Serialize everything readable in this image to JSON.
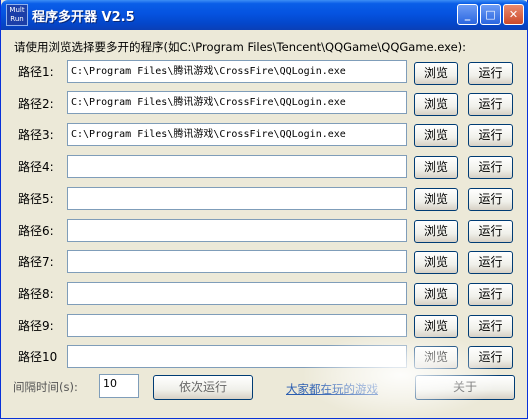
{
  "window": {
    "icon_text": "Mult\nRun",
    "title": "程序多开器 V2.5",
    "controls": {
      "minimize": "_",
      "maximize": "□",
      "close": "✕"
    }
  },
  "instruction": "请使用浏览选择要多开的程序(如C:\\Program Files\\Tencent\\QQGame\\QQGame.exe):",
  "rows": [
    {
      "label": "路径1:",
      "value": "C:\\Program Files\\腾讯游戏\\CrossFire\\QQLogin.exe",
      "browse": "浏览",
      "run": "运行"
    },
    {
      "label": "路径2:",
      "value": "C:\\Program Files\\腾讯游戏\\CrossFire\\QQLogin.exe",
      "browse": "浏览",
      "run": "运行"
    },
    {
      "label": "路径3:",
      "value": "C:\\Program Files\\腾讯游戏\\CrossFire\\QQLogin.exe",
      "browse": "浏览",
      "run": "运行"
    },
    {
      "label": "路径4:",
      "value": "",
      "browse": "浏览",
      "run": "运行"
    },
    {
      "label": "路径5:",
      "value": "",
      "browse": "浏览",
      "run": "运行"
    },
    {
      "label": "路径6:",
      "value": "",
      "browse": "浏览",
      "run": "运行"
    },
    {
      "label": "路径7:",
      "value": "",
      "browse": "浏览",
      "run": "运行"
    },
    {
      "label": "路径8:",
      "value": "",
      "browse": "浏览",
      "run": "运行"
    },
    {
      "label": "路径9:",
      "value": "",
      "browse": "浏览",
      "run": "运行"
    },
    {
      "label": "路径10",
      "value": "",
      "browse": "浏览",
      "run": "运行"
    }
  ],
  "bottom": {
    "interval_label": "间隔时间(s):",
    "interval_value": "10",
    "sequential_button": "依次运行",
    "link": "大家都在玩的游戏",
    "about_button": "关于"
  }
}
